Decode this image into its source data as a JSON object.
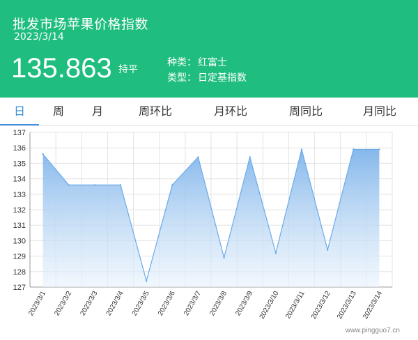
{
  "header": {
    "title": "批发市场苹果价格指数",
    "date": "2023/3/14",
    "price": "135.863",
    "change": "持平",
    "variety_label": "种类：",
    "variety_value": "红富士",
    "type_label": "类型：",
    "type_value": "日定基指数"
  },
  "tabs": [
    {
      "label": "日",
      "active": true
    },
    {
      "label": "周",
      "active": false
    },
    {
      "label": "月",
      "active": false
    },
    {
      "label": "周环比",
      "active": false
    },
    {
      "label": "月环比",
      "active": false
    },
    {
      "label": "周同比",
      "active": false
    },
    {
      "label": "月同比",
      "active": false
    }
  ],
  "colors": {
    "header_bg": "#1fbd7e",
    "active_tab": "#3a8de0",
    "line": "#6aaae8",
    "area_top": "#7fb4ea",
    "area_bottom": "#e8f2fc"
  },
  "chart_data": {
    "type": "area",
    "categories": [
      "2023/3/1",
      "2023/3/2",
      "2023/3/3",
      "2023/3/4",
      "2023/3/5",
      "2023/3/6",
      "2023/3/7",
      "2023/3/8",
      "2023/3/9",
      "2023/3/10",
      "2023/3/11",
      "2023/3/12",
      "2023/3/13",
      "2023/3/14"
    ],
    "series": [
      {
        "values": [
          135.6,
          133.6,
          133.6,
          133.6,
          127.4,
          133.6,
          135.4,
          128.9,
          135.4,
          129.2,
          135.9,
          129.4,
          135.9,
          135.9
        ]
      }
    ],
    "ylim": [
      127,
      137
    ],
    "yticks": [
      "127",
      "128",
      "129",
      "130",
      "131",
      "132",
      "133",
      "134",
      "135",
      "136",
      "137"
    ],
    "grid": true
  },
  "watermark": "www.pingguo7.cn"
}
